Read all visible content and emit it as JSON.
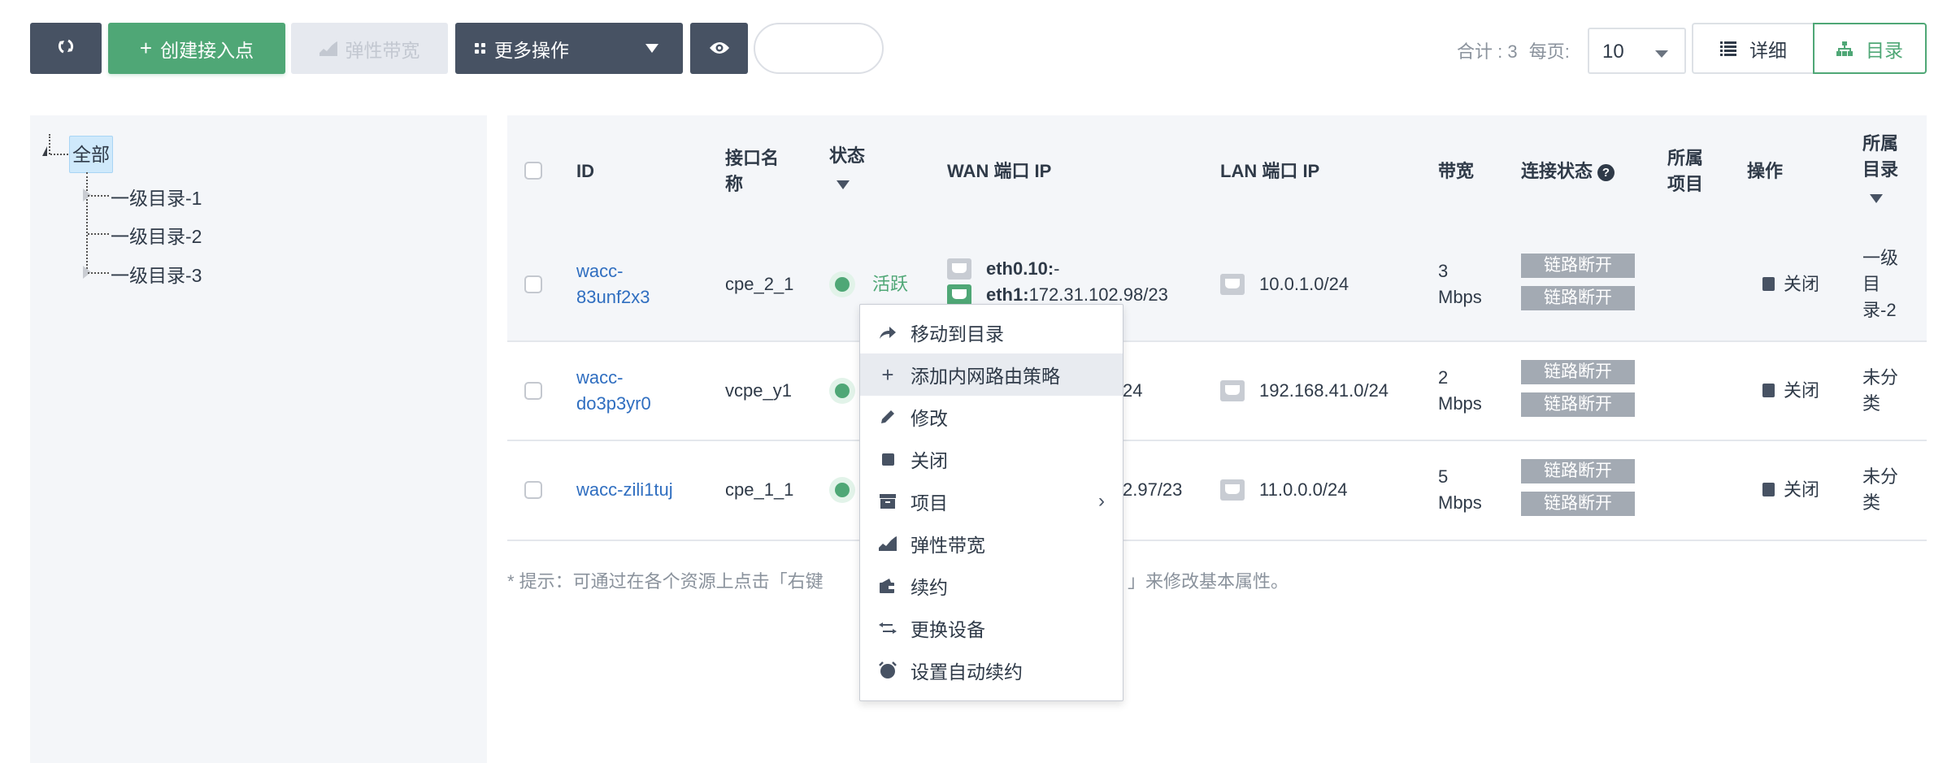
{
  "toolbar": {
    "refresh_icon": "refresh-icon",
    "create_label": "创建接入点",
    "create_icon": "plus-icon",
    "elastic_label": "弹性带宽",
    "elastic_icon": "area-chart-icon",
    "more_label": "更多操作",
    "more_icon": "grid-icon",
    "eye_icon": "eye-icon",
    "search_value": "",
    "search_placeholder": ""
  },
  "summary": {
    "total_label": "合计 : 3",
    "per_page_label": "每页:",
    "per_page_value": "10"
  },
  "view_toggle": {
    "detail_label": "详细",
    "detail_icon": "list-icon",
    "directory_label": "目录",
    "directory_icon": "sitemap-icon",
    "active": "目录"
  },
  "tree": {
    "root": "全部",
    "children": [
      "一级目录-1",
      "一级目录-2",
      "一级目录-3"
    ]
  },
  "table": {
    "headers": {
      "id": "ID",
      "iface_line1": "接口名",
      "iface_line2": "称",
      "status": "状态",
      "wan": "WAN 端口 IP",
      "lan": "LAN 端口 IP",
      "bandwidth": "带宽",
      "conn": "连接状态",
      "project_line1": "所属",
      "project_line2": "项目",
      "action": "操作",
      "dir_line1": "所属",
      "dir_line2": "目录"
    },
    "rows": [
      {
        "id_line1": "wacc-",
        "id_line2": "83unf2x3",
        "iface": "cpe_2_1",
        "status": "活跃",
        "wan_line1_label": "eth0.10:",
        "wan_line1_value": "-",
        "wan_line2_label": "eth1:",
        "wan_line2_value": "172.31.102.98/23",
        "lan": "10.0.1.0/24",
        "bw_line1": "3",
        "bw_line2": "Mbps",
        "conn": [
          "链路断开",
          "链路断开"
        ],
        "project": "",
        "action": "关闭",
        "dir_line1": "一级",
        "dir_line2": "目",
        "dir_line3": "录-2"
      },
      {
        "id_line1": "wacc-",
        "id_line2": "do3p3yr0",
        "iface": "vcpe_y1",
        "wan_visible": "24",
        "lan": "192.168.41.0/24",
        "bw_line1": "2",
        "bw_line2": "Mbps",
        "conn": [
          "链路断开",
          "链路断开"
        ],
        "project": "",
        "action": "关闭",
        "dir_line1": "未分",
        "dir_line2": "类"
      },
      {
        "id": "wacc-zili1tuj",
        "iface": "cpe_1_1",
        "wan_visible": "2.97/23",
        "lan": "11.0.0.0/24",
        "bw_line1": "5",
        "bw_line2": "Mbps",
        "conn": [
          "链路断开",
          "链路断开"
        ],
        "project": "",
        "action": "关闭",
        "dir_line1": "未分",
        "dir_line2": "类"
      }
    ]
  },
  "hint": {
    "visible_start": "* 提示：可通过在各个资源上点击「右键",
    "visible_end": "」来修改基本属性。"
  },
  "context_menu": {
    "items": [
      {
        "label": "移动到目录",
        "icon": "share-arrow-icon"
      },
      {
        "label": "添加内网路由策略",
        "icon": "plus-icon",
        "highlighted": true
      },
      {
        "label": "修改",
        "icon": "pencil-icon"
      },
      {
        "label": "关闭",
        "icon": "stop-icon"
      },
      {
        "label": "项目",
        "icon": "archive-icon",
        "has_submenu": true
      },
      {
        "label": "弹性带宽",
        "icon": "area-chart-icon"
      },
      {
        "label": "续约",
        "icon": "wallet-icon"
      },
      {
        "label": "更换设备",
        "icon": "exchange-icon"
      },
      {
        "label": "设置自动续约",
        "icon": "alarm-clock-icon"
      }
    ],
    "submenu_arrow": "›"
  },
  "colors": {
    "primary_green": "#4fa776",
    "dark_button": "#475263",
    "link_blue": "#2f6ec0",
    "badge_gray": "#a3aab3",
    "panel_bg": "#f4f6f9"
  }
}
